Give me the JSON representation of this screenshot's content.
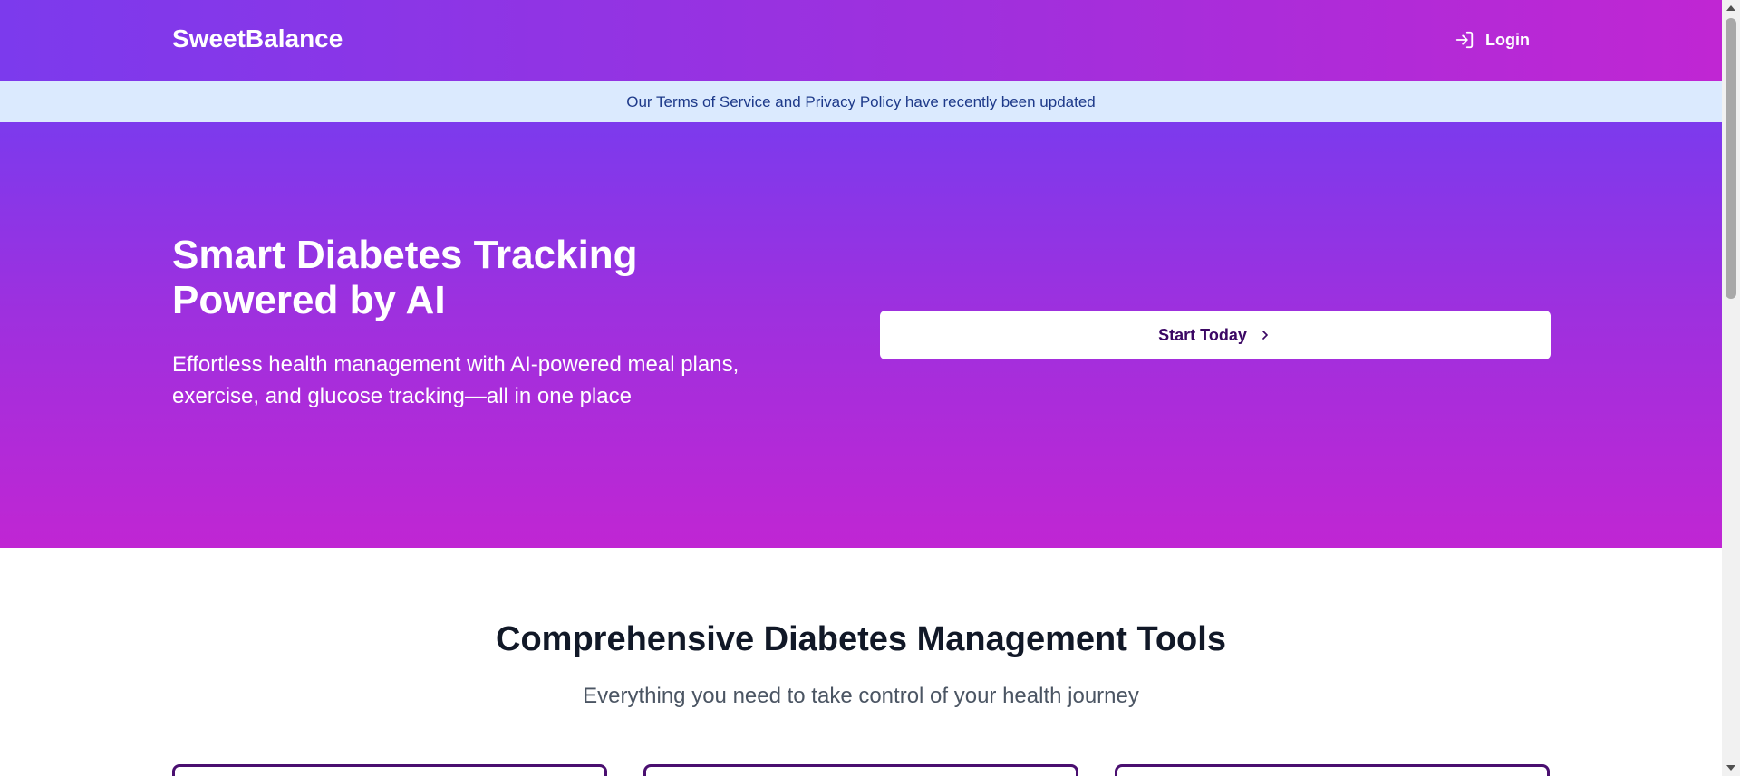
{
  "header": {
    "brand": "SweetBalance",
    "login_label": "Login",
    "login_icon": "log-in-icon"
  },
  "notice": {
    "text": "Our Terms of Service and Privacy Policy have recently been updated"
  },
  "hero": {
    "title": "Smart Diabetes Tracking Powered by AI",
    "subtitle": "Effortless health management with AI-powered meal plans, exercise, and glucose tracking—all in one place",
    "cta_label": "Start Today",
    "cta_icon": "chevron-right-icon"
  },
  "tools": {
    "title": "Comprehensive Diabetes Management Tools",
    "subtitle": "Everything you need to take control of your health journey"
  },
  "colors": {
    "brand_purple": "#7c3aed",
    "brand_magenta": "#c026d3",
    "notice_bg": "#dbeafe",
    "notice_text": "#1e3a8a",
    "cta_text": "#3b0764",
    "card_border": "#4a0f70"
  }
}
